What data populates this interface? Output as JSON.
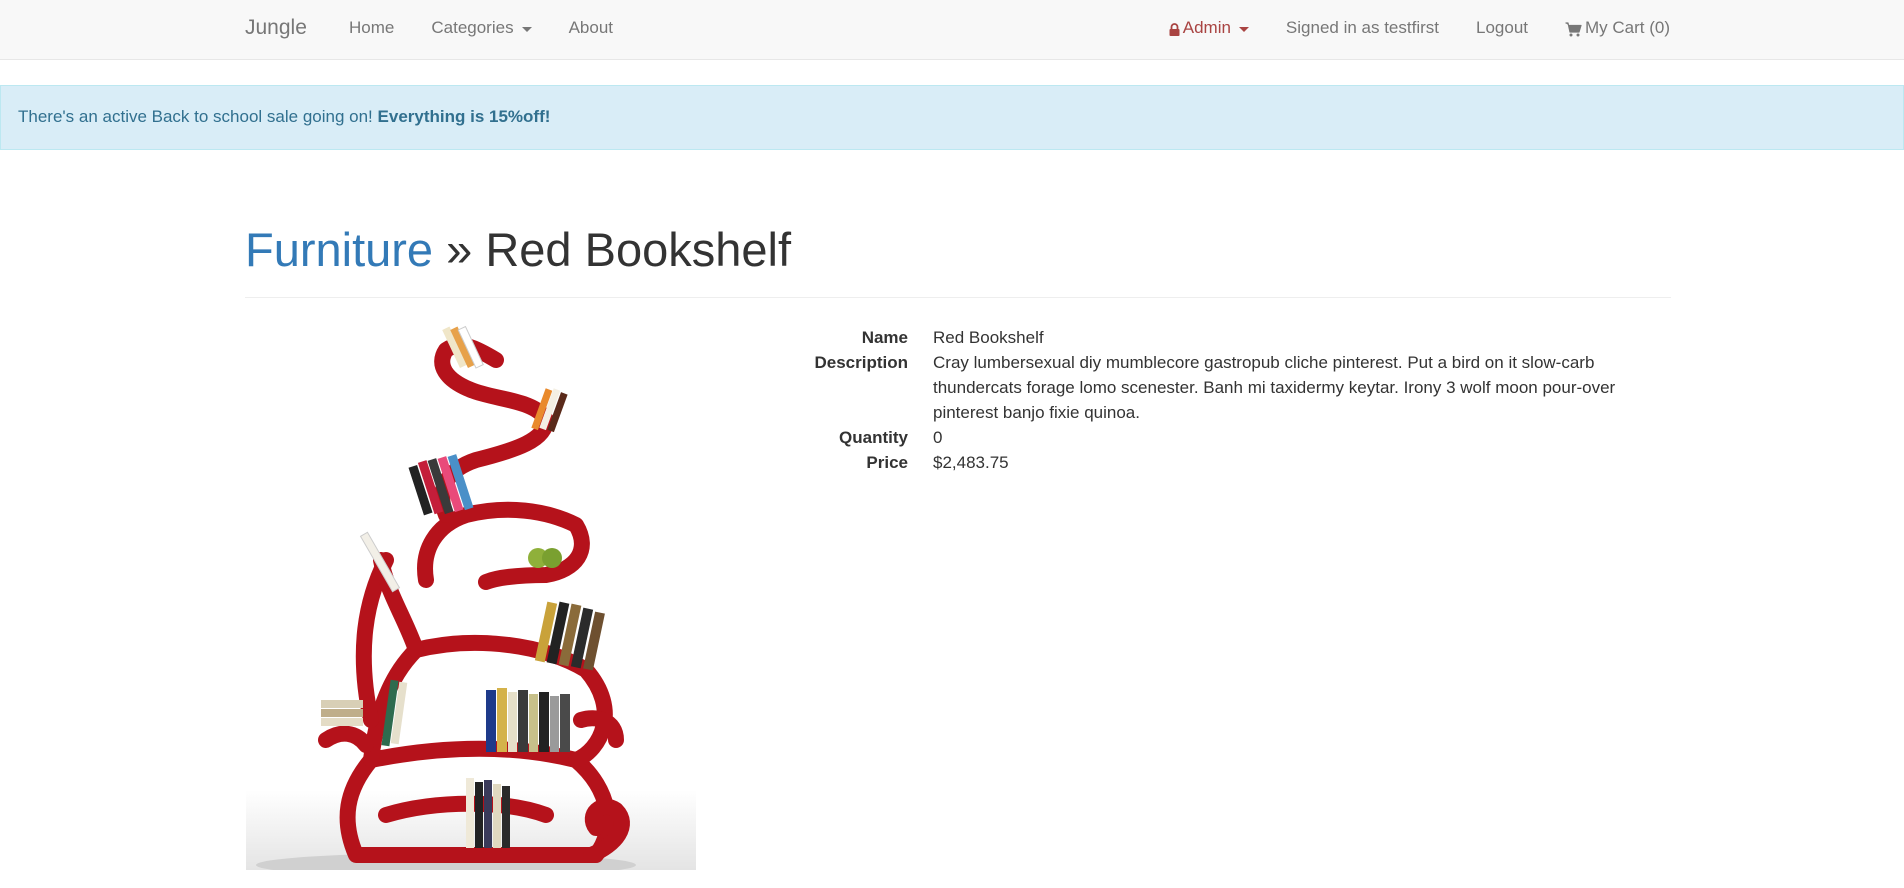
{
  "navbar": {
    "brand": "Jungle",
    "left_items": [
      {
        "label": "Home"
      },
      {
        "label": "Categories"
      },
      {
        "label": "About"
      }
    ],
    "admin_label": "Admin",
    "signed_in": "Signed in as testfirst",
    "logout": "Logout",
    "cart": "My Cart (0)"
  },
  "alert": {
    "text": "There's an active Back to school sale going on!",
    "emphasis": "Everything is 15%off!"
  },
  "header": {
    "category": "Furniture",
    "separator": "»",
    "product": "Red Bookshelf"
  },
  "details": {
    "name_label": "Name",
    "name": "Red Bookshelf",
    "description_label": "Description",
    "description": "Cray lumbersexual diy mumblecore gastropub cliche pinterest. Put a bird on it slow-carb thundercats forage lomo scenester. Banh mi taxidermy keytar. Irony 3 wolf moon pour-over pinterest banjo fixie quinoa.",
    "quantity_label": "Quantity",
    "quantity": "0",
    "price_label": "Price",
    "price": "$2,483.75"
  },
  "colors": {
    "navbar_bg": "#f8f8f8",
    "alert_bg": "#d9edf7",
    "alert_text": "#31708f",
    "link": "#337ab7",
    "admin": "#a94442",
    "shelf_red": "#b5121b"
  },
  "icons": {
    "lock": "lock-icon",
    "cart": "shopping-cart-icon",
    "caret": "caret-down-icon"
  }
}
